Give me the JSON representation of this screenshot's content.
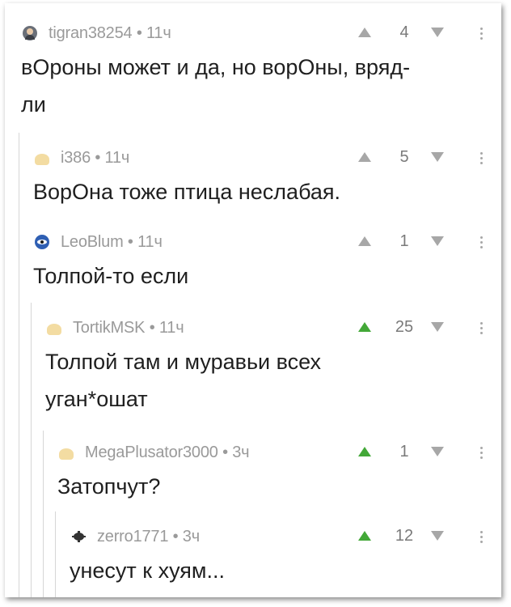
{
  "comments": [
    {
      "username": "tigran38254",
      "separator": "•",
      "time": "11ч",
      "score": "4",
      "text_lines": [
        "вОроны может и да, но ворОны, вряд-",
        "ли"
      ],
      "upvoted": false,
      "avatar_icon": "user-photo-icon"
    },
    {
      "username": "i386",
      "separator": "•",
      "time": "11ч",
      "score": "5",
      "text_lines": [
        "ВорОна тоже птица неслабая."
      ],
      "upvoted": false,
      "avatar_icon": "default-avatar-icon"
    },
    {
      "username": "LeoBlum",
      "separator": "•",
      "time": "11ч",
      "score": "1",
      "text_lines": [
        "Толпой-то если"
      ],
      "upvoted": false,
      "avatar_icon": "eye-avatar-icon"
    },
    {
      "username": "TortikMSK",
      "separator": "•",
      "time": "11ч",
      "score": "25",
      "text_lines": [
        "Толпой там и муравьи всех",
        "уган*ошат"
      ],
      "upvoted": true,
      "avatar_icon": "default-avatar-icon"
    },
    {
      "username": "MegaPlusator3000",
      "separator": "•",
      "time": "3ч",
      "score": "1",
      "text_lines": [
        "Затопчут?"
      ],
      "upvoted": true,
      "avatar_icon": "default-avatar-icon"
    },
    {
      "username": "zerro1771",
      "separator": "•",
      "time": "3ч",
      "score": "12",
      "text_lines": [
        "унесут к хуям..."
      ],
      "upvoted": true,
      "avatar_icon": "bug-avatar-icon"
    }
  ],
  "colors": {
    "upvote_active": "#43a838",
    "vote_inactive": "#a7a7a7",
    "meta_text": "#9a9a9a",
    "thread_line": "#d6d6d6"
  }
}
